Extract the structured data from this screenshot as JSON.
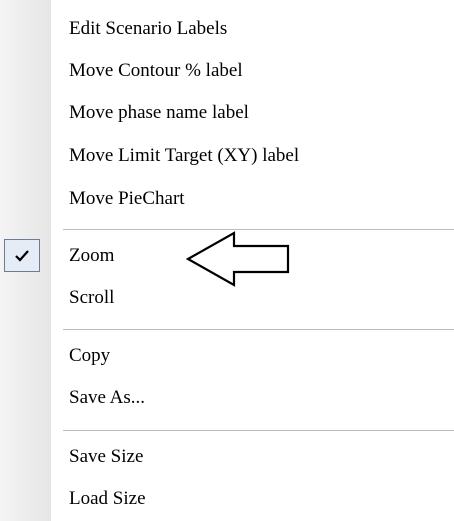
{
  "context_menu": {
    "groups": [
      {
        "items": [
          {
            "label": "Edit Scenario Labels",
            "checked": false
          },
          {
            "label": "Move Contour % label",
            "checked": false
          },
          {
            "label": "Move phase name label",
            "checked": false
          },
          {
            "label": "Move Limit  Target (XY) label",
            "checked": false
          },
          {
            "label": "Move PieChart",
            "checked": false
          }
        ]
      },
      {
        "items": [
          {
            "label": "Zoom",
            "checked": true
          },
          {
            "label": "Scroll",
            "checked": false
          }
        ]
      },
      {
        "items": [
          {
            "label": "Copy",
            "checked": false
          },
          {
            "label": "Save As...",
            "checked": false
          }
        ]
      },
      {
        "items": [
          {
            "label": "Save Size",
            "checked": false
          },
          {
            "label": "Load Size",
            "checked": false
          }
        ]
      }
    ],
    "check_icon": "check-icon",
    "annotation_icon": "left-arrow-icon"
  }
}
